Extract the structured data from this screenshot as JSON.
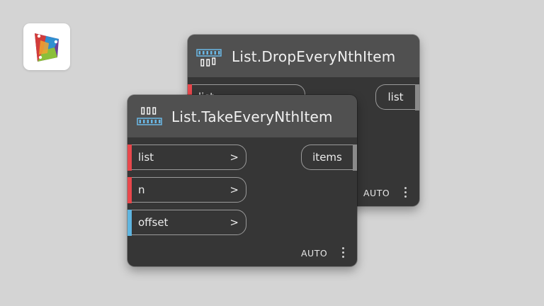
{
  "app": {
    "logo_icon": "dynamo-logo-icon"
  },
  "back_node": {
    "title": "List.DropEveryNthItem",
    "icon": "drop-every-nth-item-icon",
    "inputs": [
      {
        "label": "list",
        "accent": "#e8474c"
      }
    ],
    "output": "list",
    "lacing": "AUTO"
  },
  "front_node": {
    "title": "List.TakeEveryNthItem",
    "icon": "take-every-nth-item-icon",
    "inputs": [
      {
        "label": "list",
        "accent": "#e8474c",
        "arrow": ">"
      },
      {
        "label": "n",
        "accent": "#e8474c",
        "arrow": ">"
      },
      {
        "label": "offset",
        "accent": "#5fb5e0",
        "arrow": ">"
      }
    ],
    "output": "items",
    "lacing": "AUTO"
  }
}
